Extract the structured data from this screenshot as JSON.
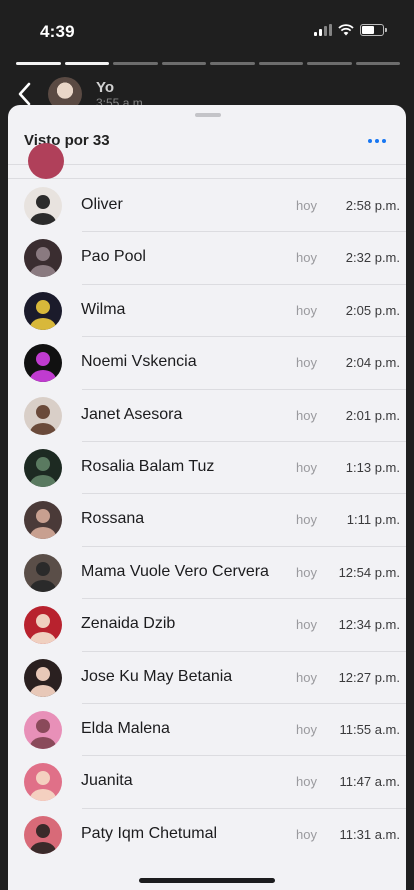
{
  "status": {
    "time": "4:39"
  },
  "story": {
    "author": "Yo",
    "posted": "3:55 a.m.",
    "segments_done": 2,
    "segments_total": 8
  },
  "sheet": {
    "title": "Visto por 33"
  },
  "viewers": [
    {
      "name": "Oliver",
      "day": "hoy",
      "time": "2:58 p.m.",
      "avatar_color": "#e8e3df",
      "avatar_accent": "#2b2b2b"
    },
    {
      "name": "Pao Pool",
      "day": "hoy",
      "time": "2:32 p.m.",
      "avatar_color": "#3a2d30",
      "avatar_accent": "#8a7a80"
    },
    {
      "name": "Wilma",
      "day": "hoy",
      "time": "2:05 p.m.",
      "avatar_color": "#1b1b2b",
      "avatar_accent": "#d8b83a"
    },
    {
      "name": "Noemi Vskencia",
      "day": "hoy",
      "time": "2:04 p.m.",
      "avatar_color": "#111111",
      "avatar_accent": "#c03bd0"
    },
    {
      "name": "Janet Asesora",
      "day": "hoy",
      "time": "2:01 p.m.",
      "avatar_color": "#d9cfc8",
      "avatar_accent": "#6a4a3a"
    },
    {
      "name": "Rosalia Balam Tuz",
      "day": "hoy",
      "time": "1:13 p.m.",
      "avatar_color": "#1d2a22",
      "avatar_accent": "#5a7a60"
    },
    {
      "name": "Rossana",
      "day": "hoy",
      "time": "1:11 p.m.",
      "avatar_color": "#4a3a38",
      "avatar_accent": "#c8a090"
    },
    {
      "name": "Mama Vuole Vero Cervera",
      "day": "hoy",
      "time": "12:54 p.m.",
      "avatar_color": "#5a4e48",
      "avatar_accent": "#2a2a2a"
    },
    {
      "name": "Zenaida Dzib",
      "day": "hoy",
      "time": "12:34 p.m.",
      "avatar_color": "#b8222e",
      "avatar_accent": "#f0d0c0"
    },
    {
      "name": "Jose Ku May Betania",
      "day": "hoy",
      "time": "12:27 p.m.",
      "avatar_color": "#2a2020",
      "avatar_accent": "#e8c8b8"
    },
    {
      "name": "Elda Malena",
      "day": "hoy",
      "time": "11:55 a.m.",
      "avatar_color": "#e890b8",
      "avatar_accent": "#8a4a5a"
    },
    {
      "name": "Juanita",
      "day": "hoy",
      "time": "11:47 a.m.",
      "avatar_color": "#e07088",
      "avatar_accent": "#f4d0c0"
    },
    {
      "name": "Paty Iqm Chetumal",
      "day": "hoy",
      "time": "11:31 a.m.",
      "avatar_color": "#d86a78",
      "avatar_accent": "#3a2a2a"
    }
  ]
}
